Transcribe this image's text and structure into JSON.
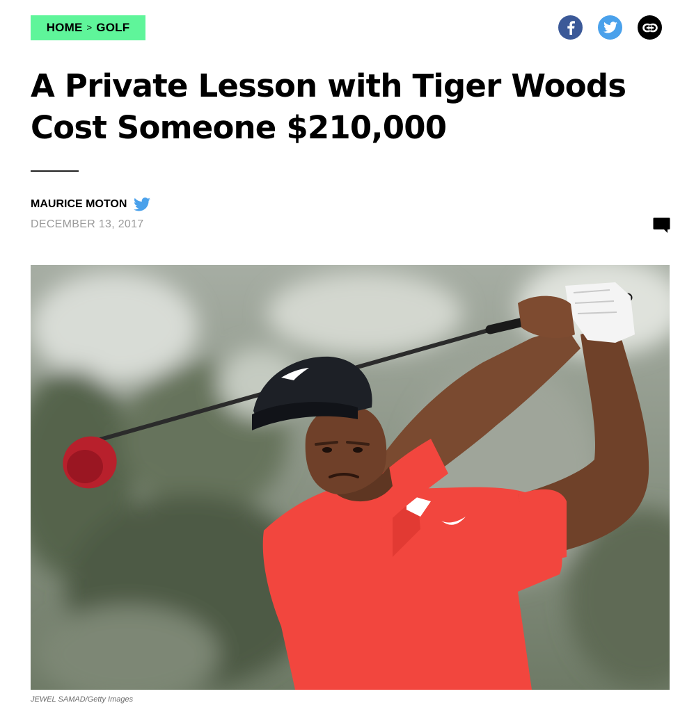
{
  "breadcrumb": {
    "home": "HOME",
    "separator": ">",
    "section": "GOLF"
  },
  "share": {
    "facebook_icon": "facebook-icon",
    "twitter_icon": "twitter-icon",
    "link_icon": "link-icon"
  },
  "article": {
    "title": "A Private Lesson with Tiger Woods Cost Someone $210,000",
    "author": "MAURICE MOTON",
    "date": "DECEMBER 13, 2017",
    "photo_credit": "JEWEL SAMAD/Getty Images",
    "comment_icon": "comment-icon"
  },
  "colors": {
    "breadcrumb_bg": "#5ff59a",
    "facebook": "#3b5998",
    "twitter": "#4aa1eb",
    "link": "#000000",
    "shirt": "#f2463e"
  }
}
